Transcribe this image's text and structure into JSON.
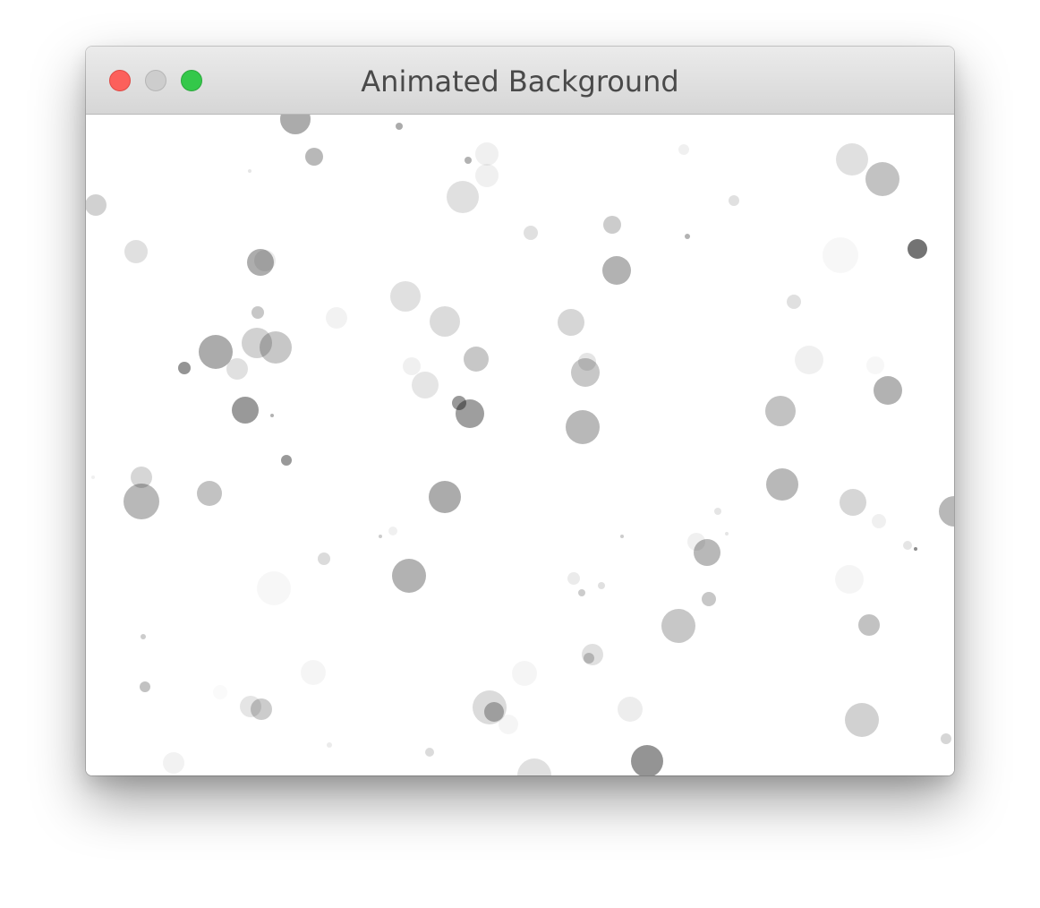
{
  "window": {
    "title": "Animated Background",
    "controls": {
      "close_color": "#fc605b",
      "minimize_color": "#cdcdcd",
      "zoom_color": "#34c84a"
    }
  },
  "scene": {
    "background_color": "#ffffff",
    "particle_color": "#000000"
  }
}
